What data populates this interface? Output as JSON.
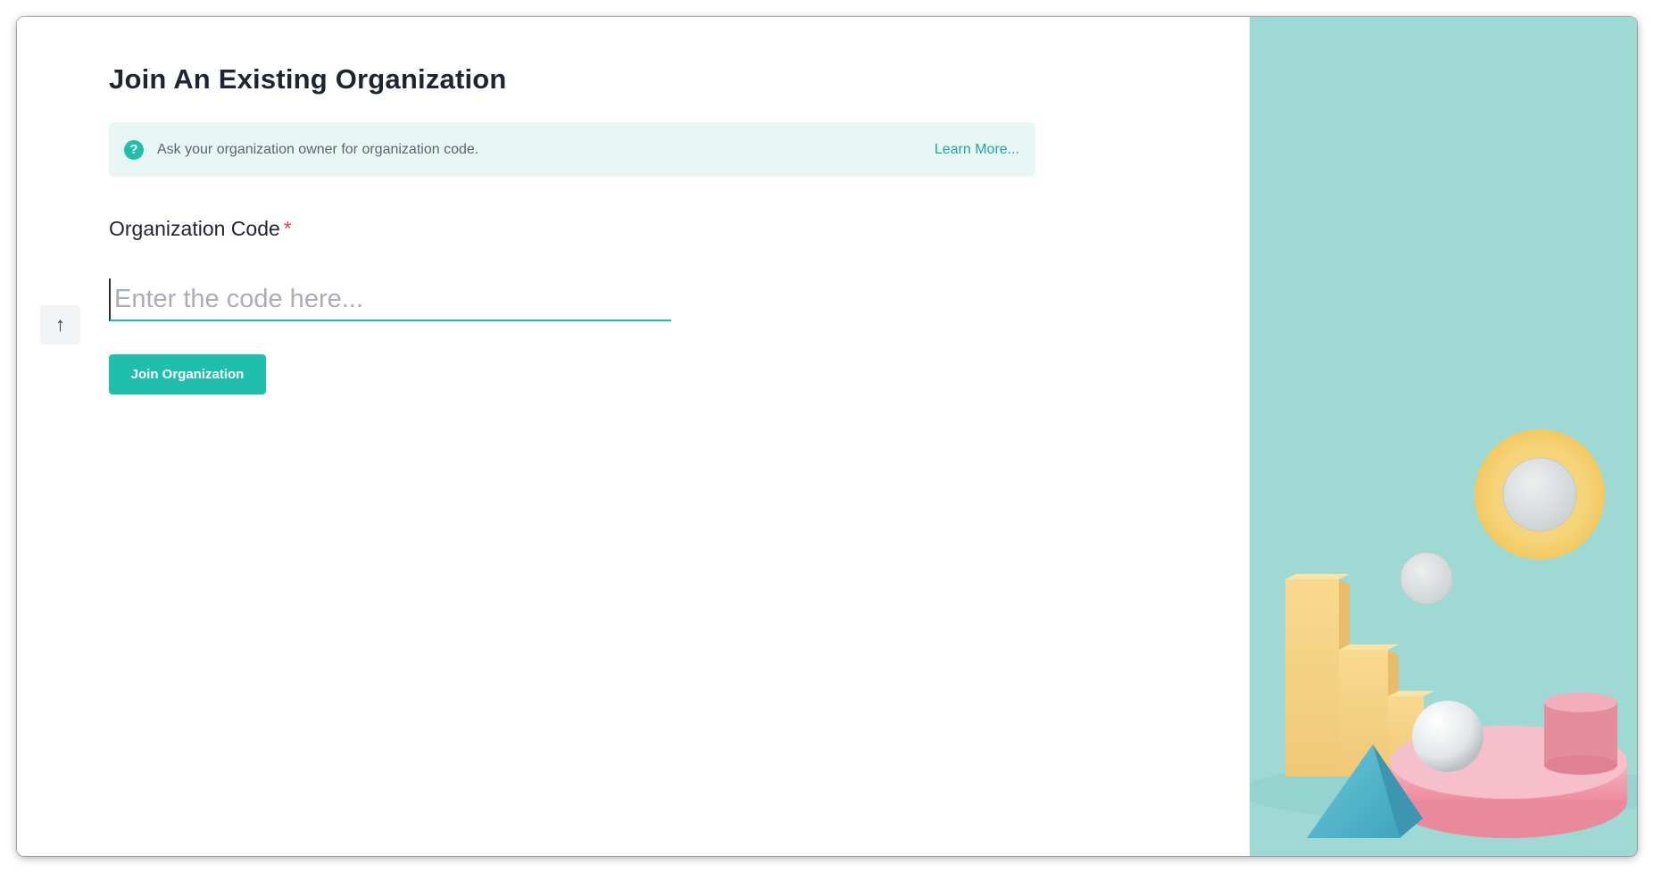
{
  "page": {
    "title": "Join An Existing Organization"
  },
  "info": {
    "icon": "help-circle-icon",
    "text": "Ask your organization owner for organization code.",
    "link_label": "Learn More..."
  },
  "form": {
    "code_label": "Organization Code",
    "required_mark": "*",
    "code_placeholder": "Enter the code here...",
    "code_value": "",
    "submit_label": "Join Organization"
  },
  "scroll_top": {
    "icon": "arrow-up-icon",
    "glyph": "↑"
  },
  "colors": {
    "accent": "#20bfab",
    "info_background": "#e8f6f5",
    "illustration_background": "#9ed9d4",
    "required": "#e0464d",
    "title": "#1f2432"
  }
}
